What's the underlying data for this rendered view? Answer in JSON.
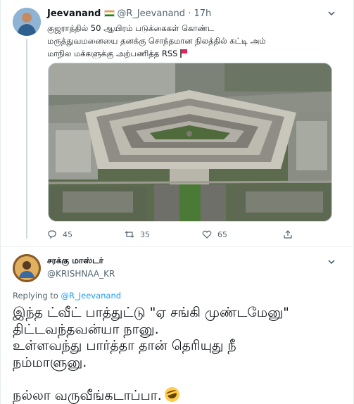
{
  "tweet": {
    "author_name": "Jeevanand",
    "author_handle": "@R_Jeevanand",
    "separator": "·",
    "time": "17h",
    "text_lines": [
      "குஜராத்தில் 50 ஆயிரம் படுக்கைகள் கொண்ட",
      "மருத்துவமனையை தனக்கு சொந்தமான நிலத்தில் கட்டி அம்",
      "மாநில மக்களுக்கு அற்பணித்த RSS"
    ],
    "replies": "45",
    "retweets": "35",
    "likes": "65"
  },
  "reply": {
    "author_name": "சரக்கு மாஸ்டர்",
    "author_handle": "@KRISHNAA_KR",
    "replying_prefix": "Replying to",
    "replying_handle": "@R_Jeevanand",
    "text_lines": [
      "இந்த ட்வீட் பாத்துட்டு \"ஏ சங்கி முண்டமேனு\"",
      "திட்டவந்தவன்யா நானு.",
      "உள்ளவந்து பார்த்தா தான் தெரியுது நீ",
      "நம்மாளுனு.",
      "நல்லா வருவீங்கடாப்பா."
    ]
  },
  "icons": {
    "flag": "india-flag-icon",
    "red_flag": "red-flag-icon",
    "emoji": "rolling-laughing-emoji-icon",
    "caret": "chevron-down-icon"
  },
  "colors": {
    "link": "#1d9bf0",
    "muted": "#536471",
    "text": "#0f1419"
  }
}
